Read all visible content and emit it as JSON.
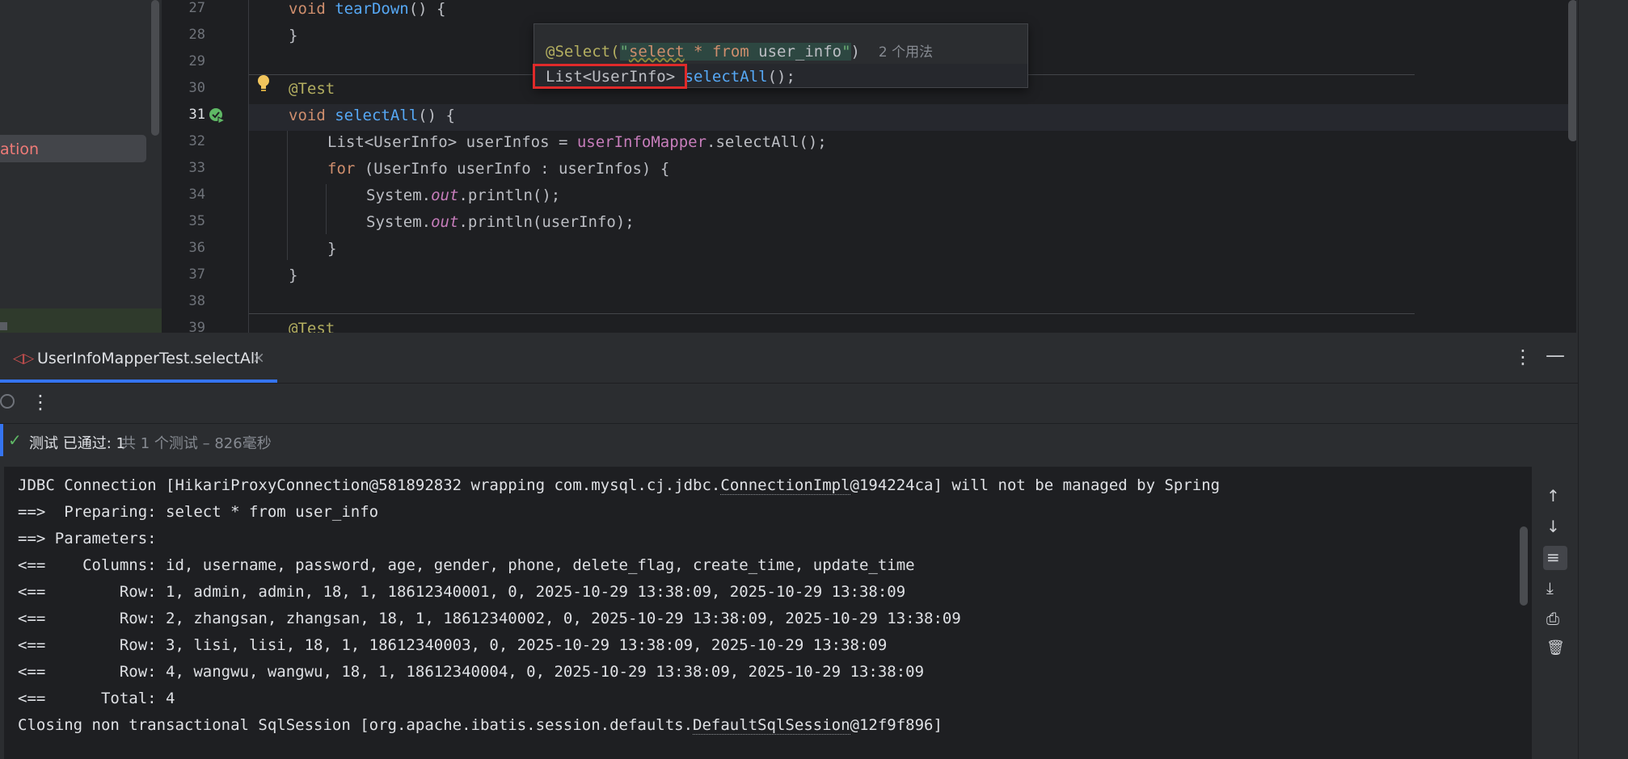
{
  "project_panel": {
    "selected_item_label": "ation"
  },
  "editor": {
    "line_numbers": [
      "27",
      "28",
      "29",
      "30",
      "31",
      "32",
      "33",
      "34",
      "35",
      "36",
      "37",
      "38",
      "39"
    ],
    "code": {
      "l27_kw": "void",
      "l27_fn": "tearDown",
      "l27_rest": "() {",
      "l28": "}",
      "l30": "@Test",
      "l31_kw": "void",
      "l31_fn": "selectAll",
      "l31_rest": "() {",
      "l32_a": "List<UserInfo> userInfos = ",
      "l32_fld": "userInfoMapper",
      "l32_b": ".selectAll();",
      "l33_kw": "for",
      "l33_rest": " (UserInfo userInfo : userInfos) {",
      "l34_a": "System.",
      "l34_it": "out",
      "l34_b": ".println();",
      "l35_a": "System.",
      "l35_it": "out",
      "l35_b": ".println(userInfo);",
      "l36": "}",
      "l37": "}",
      "l39": "@Test"
    },
    "popup": {
      "annotation": "@Select(",
      "quote_open": "\"",
      "sql_kw1": "select",
      "sql_star": " * ",
      "sql_kw2": "from",
      "sql_table": " user_info",
      "quote_close": "\"",
      "paren": ")",
      "usages": "2 个用法",
      "return_type": "List<UserInfo>",
      "method": "selectAll",
      "tail": "();"
    }
  },
  "run_window": {
    "tab_label": "UserInfoMapperTest.selectAll",
    "tab_close": "×",
    "more_menu": "⋮",
    "minimize": "—",
    "toolbar_more": "⋮",
    "status": {
      "check": "✓",
      "passed_text": "测试 已通过: 1",
      "detail": "共 1 个测试 – 826毫秒"
    },
    "console_lines": [
      {
        "pre": "JDBC Connection [HikariProxyConnection@581892832 wrapping com.mysql.cj.jdbc.",
        "link": "ConnectionImpl",
        "post": "@194224ca] will not be managed by Spring"
      },
      {
        "pre": "==>  Preparing: select * from user_info",
        "link": "",
        "post": ""
      },
      {
        "pre": "==> Parameters: ",
        "link": "",
        "post": ""
      },
      {
        "pre": "<==    Columns: id, username, password, age, gender, phone, delete_flag, create_time, update_time",
        "link": "",
        "post": ""
      },
      {
        "pre": "<==        Row: 1, admin, admin, 18, 1, 18612340001, 0, 2025-10-29 13:38:09, 2025-10-29 13:38:09",
        "link": "",
        "post": ""
      },
      {
        "pre": "<==        Row: 2, zhangsan, zhangsan, 18, 1, 18612340002, 0, 2025-10-29 13:38:09, 2025-10-29 13:38:09",
        "link": "",
        "post": ""
      },
      {
        "pre": "<==        Row: 3, lisi, lisi, 18, 1, 18612340003, 0, 2025-10-29 13:38:09, 2025-10-29 13:38:09",
        "link": "",
        "post": ""
      },
      {
        "pre": "<==        Row: 4, wangwu, wangwu, 18, 1, 18612340004, 0, 2025-10-29 13:38:09, 2025-10-29 13:38:09",
        "link": "",
        "post": ""
      },
      {
        "pre": "<==      Total: 4",
        "link": "",
        "post": ""
      },
      {
        "pre": "Closing non transactional SqlSession [org.apache.ibatis.session.defaults.",
        "link": "DefaultSqlSession",
        "post": "@12f9f896]"
      }
    ],
    "right_tools": {
      "up": "↑",
      "down": "↓",
      "wrap": "≡",
      "scroll_end": "⤓",
      "print": "⎙",
      "clear": "🗑"
    }
  },
  "colors": {
    "accent": "#3574f0",
    "pass": "#5fb865",
    "highlight_box": "#e02a2a"
  }
}
